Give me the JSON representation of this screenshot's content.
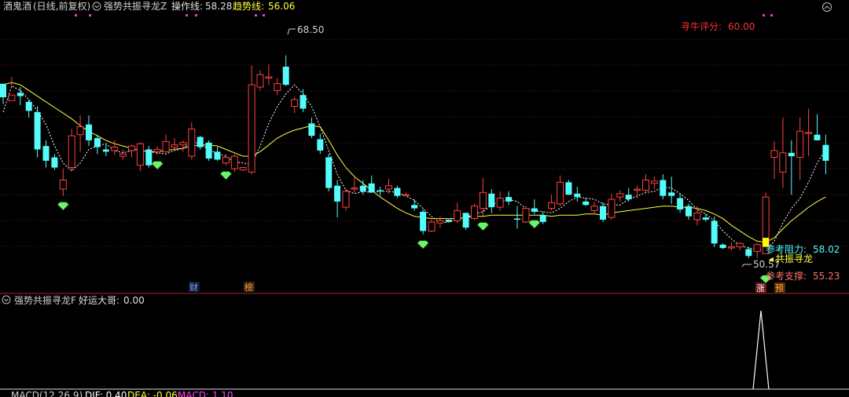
{
  "header": {
    "stock": "酒鬼酒",
    "mode": "(日线,前复权)",
    "indicator": "强势共振寻龙Z",
    "op_label": "操作线:",
    "op_value": "58.28",
    "trend_label": "趋势线:",
    "trend_value": "56.06"
  },
  "score": {
    "label": "寻牛评分:",
    "value": "60.00"
  },
  "sub": {
    "indicator": "强势共振寻龙F",
    "label": "好运大哥:",
    "value": "0.00"
  },
  "macd": {
    "label": "MACD(12,26,9)",
    "dif": "DIF: 0.40",
    "dea": "DEA: -0.06",
    "macd": "MACD: 1.10"
  },
  "events": {
    "cai": "财",
    "bang": "榜",
    "zhang": "涨",
    "yu": "预"
  },
  "colors": {
    "bg": "#000000",
    "up": "#ff4040",
    "down": "#54fcfc",
    "ma": "#ffff40",
    "dash": "#ffffff",
    "gem": "#6cf46c",
    "grid": "#a0262e"
  },
  "chart_data": {
    "type": "candlestick",
    "high_label": "68.50",
    "low_label": "50.57",
    "annotations": {
      "resistance": {
        "label": "参考阻力:",
        "value": "58.02"
      },
      "support": {
        "label": "参考支撑:",
        "value": "55.23"
      },
      "signal": "共振寻龙"
    },
    "ylim": [
      49.5,
      72.0
    ],
    "candles": [
      [
        1,
        66.0,
        65.5,
        64.2,
        64.8
      ],
      [
        2,
        64.5,
        66.6,
        65.8,
        65.0
      ],
      [
        3,
        65.2,
        65.7,
        64.1,
        64.9
      ],
      [
        4,
        64.4,
        64.6,
        63.0,
        63.6
      ],
      [
        5,
        63.5,
        64.0,
        59.5,
        60.2
      ],
      [
        6,
        60.5,
        61.0,
        58.6,
        59.2
      ],
      [
        7,
        59.5,
        59.8,
        58.4,
        58.6
      ],
      [
        8,
        56.7,
        58.5,
        56.1,
        57.5
      ],
      [
        9,
        58.6,
        62.0,
        58.4,
        61.4
      ],
      [
        10,
        61.5,
        63.2,
        60.0,
        62.2
      ],
      [
        11,
        62.4,
        63.2,
        60.5,
        61.0
      ],
      [
        12,
        61.2,
        61.5,
        59.8,
        60.4
      ],
      [
        13,
        60.2,
        60.7,
        59.6,
        60.0
      ],
      [
        14,
        60.1,
        61.0,
        59.7,
        60.4
      ],
      [
        15,
        59.6,
        60.2,
        59.3,
        59.8
      ],
      [
        16,
        60.1,
        60.6,
        59.5,
        60.5
      ],
      [
        17,
        58.8,
        60.8,
        58.3,
        60.7
      ],
      [
        18,
        60.2,
        60.5,
        58.6,
        58.8
      ],
      [
        19,
        60.0,
        60.5,
        59.7,
        60.2
      ],
      [
        20,
        60.0,
        61.5,
        59.9,
        60.9
      ],
      [
        21,
        60.4,
        61.2,
        60.1,
        60.6
      ],
      [
        22,
        60.6,
        61.0,
        60.0,
        60.8
      ],
      [
        23,
        59.6,
        62.6,
        59.3,
        62.0
      ],
      [
        24,
        61.3,
        61.4,
        60.2,
        60.4
      ],
      [
        25,
        60.8,
        61.0,
        59.2,
        59.4
      ],
      [
        26,
        60.0,
        60.4,
        59.2,
        59.3
      ],
      [
        27,
        59.0,
        59.8,
        58.8,
        59.5
      ],
      [
        28,
        58.5,
        59.8,
        58.2,
        59.6
      ],
      [
        29,
        58.4,
        58.6,
        58.3,
        58.6
      ],
      [
        30,
        58.2,
        67.6,
        58.0,
        65.9
      ],
      [
        31,
        65.7,
        67.2,
        65.4,
        66.8
      ],
      [
        32,
        66.5,
        67.7,
        65.9,
        66.6
      ],
      [
        33,
        65.4,
        66.5,
        65.0,
        66.0
      ],
      [
        34,
        67.5,
        68.5,
        65.8,
        65.9
      ],
      [
        35,
        64.0,
        64.8,
        63.4,
        64.6
      ],
      [
        36,
        65.0,
        65.5,
        63.5,
        63.8
      ],
      [
        37,
        62.5,
        63.0,
        61.2,
        61.4
      ],
      [
        38,
        61.1,
        61.6,
        59.8,
        60.1
      ],
      [
        39,
        59.5,
        59.8,
        56.5,
        56.8
      ],
      [
        40,
        57.0,
        57.5,
        54.2,
        55.6
      ],
      [
        41,
        55.1,
        56.7,
        54.8,
        56.5
      ],
      [
        42,
        56.7,
        57.8,
        56.4,
        56.8
      ],
      [
        43,
        57.0,
        57.5,
        56.2,
        56.5
      ],
      [
        44,
        57.2,
        57.9,
        56.7,
        56.4
      ],
      [
        45,
        56.6,
        56.9,
        56.1,
        56.5
      ],
      [
        46,
        56.7,
        57.6,
        56.3,
        57.0
      ],
      [
        47,
        56.8,
        57.0,
        55.9,
        56.1
      ],
      [
        48,
        56.2,
        56.4,
        56.1,
        56.2
      ],
      [
        49,
        55.3,
        55.8,
        54.8,
        55.0
      ],
      [
        50,
        54.7,
        54.9,
        52.7,
        53.0
      ],
      [
        51,
        53.0,
        54.0,
        52.9,
        53.8
      ],
      [
        52,
        53.7,
        54.3,
        53.3,
        53.9
      ],
      [
        53,
        54.0,
        54.0,
        53.8,
        53.8
      ],
      [
        54,
        53.9,
        55.5,
        53.7,
        54.8
      ],
      [
        55,
        54.6,
        54.6,
        53.1,
        53.3
      ],
      [
        56,
        54.1,
        55.4,
        54.0,
        55.2
      ],
      [
        57,
        55.0,
        57.7,
        54.3,
        56.4
      ],
      [
        58,
        56.3,
        56.7,
        54.6,
        55.1
      ],
      [
        59,
        55.1,
        56.5,
        54.8,
        55.9
      ],
      [
        60,
        56.0,
        56.5,
        55.3,
        55.6
      ],
      [
        61,
        54.1,
        55.2,
        53.2,
        54.0
      ],
      [
        62,
        53.8,
        55.2,
        53.7,
        55.0
      ],
      [
        63,
        55.0,
        55.8,
        54.5,
        54.7
      ],
      [
        64,
        54.4,
        54.7,
        53.6,
        53.8
      ],
      [
        65,
        55.0,
        56.2,
        54.8,
        55.5
      ],
      [
        66,
        55.4,
        57.9,
        55.2,
        57.3
      ],
      [
        67,
        57.3,
        57.5,
        56.2,
        56.2
      ],
      [
        68,
        56.3,
        56.9,
        55.6,
        56.0
      ],
      [
        69,
        55.6,
        55.9,
        55.2,
        55.3
      ],
      [
        70,
        54.8,
        55.6,
        54.5,
        55.2
      ],
      [
        71,
        55.2,
        55.5,
        53.8,
        54.0
      ],
      [
        72,
        54.2,
        56.3,
        54.0,
        55.8
      ],
      [
        73,
        56.0,
        56.6,
        55.6,
        56.3
      ],
      [
        74,
        56.2,
        56.8,
        55.6,
        55.8
      ],
      [
        75,
        56.6,
        57.0,
        55.9,
        56.7
      ],
      [
        76,
        56.6,
        58.0,
        56.3,
        57.5
      ],
      [
        77,
        57.2,
        57.8,
        56.7,
        57.4
      ],
      [
        78,
        57.5,
        58.0,
        55.8,
        56.1
      ],
      [
        79,
        56.4,
        57.8,
        55.4,
        56.1
      ],
      [
        80,
        55.9,
        56.3,
        54.6,
        54.9
      ],
      [
        81,
        55.2,
        55.4,
        54.0,
        54.3
      ],
      [
        82,
        54.0,
        55.2,
        53.5,
        54.6
      ],
      [
        83,
        54.2,
        54.5,
        53.8,
        54.0
      ],
      [
        84,
        53.9,
        54.3,
        51.6,
        51.9
      ],
      [
        85,
        51.8,
        51.9,
        51.4,
        51.5
      ],
      [
        86,
        51.5,
        52.0,
        51.3,
        51.6
      ],
      [
        87,
        51.6,
        52.0,
        51.3,
        51.9
      ],
      [
        88,
        51.4,
        51.6,
        50.6,
        50.8
      ],
      [
        89,
        51.2,
        51.9,
        50.6,
        51.8
      ],
      [
        90,
        51.0,
        56.4,
        51.0,
        56.0
      ],
      [
        91,
        59.5,
        60.9,
        57.6,
        60.1
      ],
      [
        92,
        58.2,
        63.0,
        56.8,
        59.9
      ],
      [
        93,
        59.9,
        61.0,
        56.2,
        59.6
      ],
      [
        94,
        59.5,
        63.0,
        57.5,
        61.8
      ],
      [
        95,
        61.6,
        63.8,
        59.6,
        61.7
      ],
      [
        96,
        61.5,
        63.3,
        61.0,
        61.0
      ],
      [
        97,
        60.6,
        61.5,
        58.0,
        59.2
      ]
    ],
    "ma": [
      65.9,
      66.1,
      65.9,
      65.4,
      64.9,
      64.4,
      63.9,
      63.4,
      62.9,
      62.3,
      61.8,
      61.4,
      61.0,
      60.7,
      60.5,
      60.3,
      60.1,
      60.0,
      60.0,
      60.1,
      60.2,
      60.3,
      60.5,
      60.6,
      60.6,
      60.5,
      60.2,
      59.9,
      59.6,
      59.6,
      60.0,
      60.6,
      61.2,
      61.6,
      61.9,
      62.1,
      62.3,
      62.2,
      61.0,
      59.7,
      58.6,
      57.8,
      57.2,
      56.6,
      56.0,
      55.5,
      55.0,
      54.6,
      54.3,
      54.2,
      54.1,
      54.1,
      54.1,
      54.1,
      54.2,
      54.3,
      54.3,
      54.4,
      54.4,
      54.4,
      54.4,
      54.4,
      54.4,
      54.4,
      54.3,
      54.4,
      54.4,
      54.4,
      54.5,
      54.5,
      54.4,
      54.6,
      54.7,
      54.8,
      54.9,
      55.0,
      55.1,
      55.2,
      55.2,
      55.1,
      55.1,
      55.0,
      54.8,
      54.5,
      54.1,
      53.5,
      53.0,
      52.5,
      52.1,
      52.0,
      52.4,
      53.2,
      53.9,
      54.5,
      55.1,
      55.6,
      56.0
    ],
    "dash": [
      63.5,
      65.8,
      65.4,
      64.6,
      63.6,
      62.4,
      60.5,
      59.0,
      58.3,
      59.0,
      60.2,
      60.5,
      60.7,
      60.1,
      59.9,
      60.1,
      60.1,
      60.0,
      59.9,
      59.8,
      60.1,
      60.3,
      60.9,
      60.7,
      60.2,
      59.8,
      59.6,
      59.1,
      59.0,
      58.9,
      60.5,
      62.5,
      64.0,
      65.1,
      65.9,
      65.1,
      64.0,
      62.2,
      60.1,
      58.0,
      56.6,
      56.3,
      56.5,
      56.4,
      56.5,
      56.5,
      56.4,
      56.1,
      55.7,
      55.0,
      54.3,
      53.7,
      53.8,
      54.0,
      54.2,
      54.5,
      54.7,
      55.3,
      55.6,
      55.8,
      55.6,
      55.0,
      54.8,
      54.7,
      54.6,
      55.0,
      55.6,
      56.0,
      55.9,
      55.8,
      55.4,
      55.3,
      55.3,
      55.8,
      56.1,
      56.4,
      56.5,
      56.9,
      56.8,
      56.3,
      55.7,
      54.9,
      54.5,
      53.9,
      53.0,
      52.3,
      51.7,
      51.5,
      51.4,
      51.3,
      52.1,
      53.7,
      55.0,
      55.9,
      57.3,
      59.0,
      60.2
    ],
    "gems_below": [
      8,
      19,
      27,
      50,
      57,
      63
    ]
  }
}
